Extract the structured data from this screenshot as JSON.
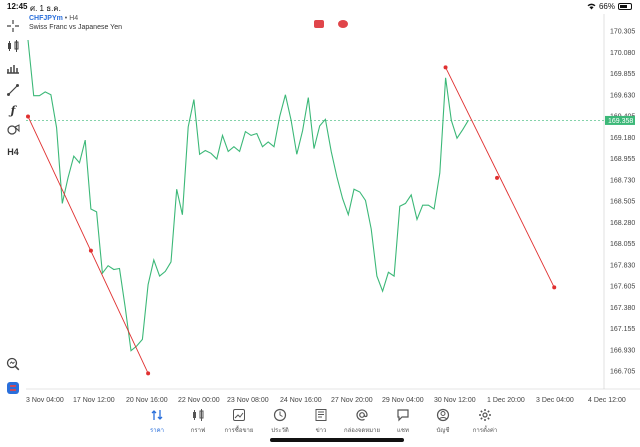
{
  "status": {
    "time": "12:45",
    "date": "ศ. 1 ธ.ค.",
    "battery": "66%"
  },
  "symbol": {
    "code": "CHFJPYm",
    "timeframe": "H4",
    "description": "Swiss Franc vs Japanese Yen"
  },
  "toolbar_tools": [
    "crosshair-icon",
    "candles-icon",
    "indicators-icon",
    "lines-icon",
    "function-icon",
    "objects-icon",
    "timeframe"
  ],
  "toolbar_timeframe_label": "H4",
  "price_axis": [
    "170.305",
    "170.080",
    "169.855",
    "169.630",
    "169.405",
    "169.180",
    "168.955",
    "168.730",
    "168.505",
    "168.280",
    "168.055",
    "167.830",
    "167.605",
    "167.380",
    "167.155",
    "166.930",
    "166.705"
  ],
  "current_price": "169.358",
  "time_axis": [
    "3 Nov 04:00",
    "17 Nov 12:00",
    "20 Nov 16:00",
    "22 Nov 00:00",
    "23 Nov 08:00",
    "24 Nov 16:00",
    "27 Nov 20:00",
    "29 Nov 04:00",
    "30 Nov 12:00",
    "1 Dec 20:00",
    "3 Dec 04:00",
    "4 Dec 12:00"
  ],
  "colors": {
    "line": "#3cb878",
    "trend": "#e03030",
    "accent": "#2a6fdb",
    "price_tag": "#3cb878"
  },
  "series": [
    170.21,
    169.62,
    169.62,
    169.66,
    169.63,
    169.28,
    168.48,
    168.75,
    168.98,
    168.91,
    169.15,
    168.42,
    168.39,
    167.74,
    167.82,
    167.78,
    167.79,
    167.38,
    166.92,
    166.97,
    167.04,
    167.62,
    167.88,
    167.71,
    167.76,
    167.86,
    168.63,
    168.36,
    169.29,
    169.58,
    169.0,
    169.04,
    169.01,
    168.95,
    169.2,
    169.03,
    169.08,
    169.03,
    169.24,
    169.2,
    169.22,
    169.08,
    169.13,
    169.08,
    169.4,
    169.63,
    169.36,
    169.0,
    169.25,
    169.6,
    169.06,
    169.3,
    169.37,
    169.03,
    168.76,
    168.53,
    168.36,
    168.63,
    168.6,
    168.51,
    168.21,
    167.71,
    167.55,
    167.75,
    167.71,
    168.45,
    168.48,
    168.57,
    168.31,
    168.46,
    168.46,
    168.42,
    168.8,
    169.81,
    169.36,
    169.17,
    169.26,
    169.36
  ],
  "trend_lines": [
    {
      "from": [
        0,
        169.4
      ],
      "mid": [
        11,
        167.98
      ],
      "to": [
        21,
        166.68
      ]
    },
    {
      "from": [
        73,
        169.92
      ],
      "mid": [
        82,
        168.75
      ],
      "to": [
        92,
        167.59
      ]
    }
  ],
  "nav": [
    {
      "label": "ราคา",
      "icon": "quotes-icon",
      "active": true
    },
    {
      "label": "กราฟ",
      "icon": "chart-icon",
      "active": false
    },
    {
      "label": "การซื้อขาย",
      "icon": "trade-icon",
      "active": false
    },
    {
      "label": "ประวัติ",
      "icon": "history-icon",
      "active": false
    },
    {
      "label": "ข่าว",
      "icon": "news-icon",
      "active": false
    },
    {
      "label": "กล่องจดหมาย",
      "icon": "mailbox-icon",
      "active": false
    },
    {
      "label": "แชท",
      "icon": "chat-icon",
      "active": false
    },
    {
      "label": "บัญชี",
      "icon": "account-icon",
      "active": false
    },
    {
      "label": "การตั้งค่า",
      "icon": "settings-icon",
      "active": false
    }
  ]
}
